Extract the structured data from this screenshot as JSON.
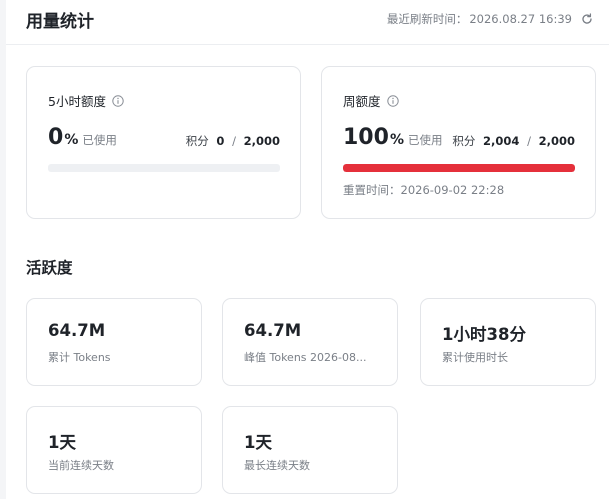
{
  "header": {
    "title": "用量统计",
    "refresh_label": "最近刷新时间：",
    "refresh_time": "2026.08.27 16:39"
  },
  "quotas": [
    {
      "title": "5小时额度",
      "value": "0",
      "percent_sign": "%",
      "used_label": "已使用",
      "points_label": "积分",
      "points_used": "0",
      "points_separator": "/",
      "points_total": "2,000",
      "progress_percent": 0
    },
    {
      "title": "周额度",
      "value": "100",
      "percent_sign": "%",
      "used_label": "已使用",
      "points_label": "积分",
      "points_used": "2,004",
      "points_separator": "/",
      "points_total": "2,000",
      "progress_percent": 100,
      "reset_label": "重置时间：",
      "reset_time": "2026-09-02 22:28"
    }
  ],
  "activity": {
    "title": "活跃度",
    "stats": [
      {
        "value": "64.7M",
        "label": "累计 Tokens"
      },
      {
        "value": "64.7M",
        "label": "峰值 Tokens 2026-08..."
      },
      {
        "value": "1小时38分",
        "label": "累计使用时长"
      },
      {
        "value": "1天",
        "label": "当前连续天数"
      },
      {
        "value": "1天",
        "label": "最长连续天数"
      }
    ]
  },
  "colors": {
    "accent_red": "#e5303b",
    "text_primary": "#1f2329",
    "text_secondary": "#7a7f87",
    "progress_track": "#eef0f3"
  },
  "icons": {
    "refresh": "refresh-icon",
    "info": "info-icon"
  }
}
